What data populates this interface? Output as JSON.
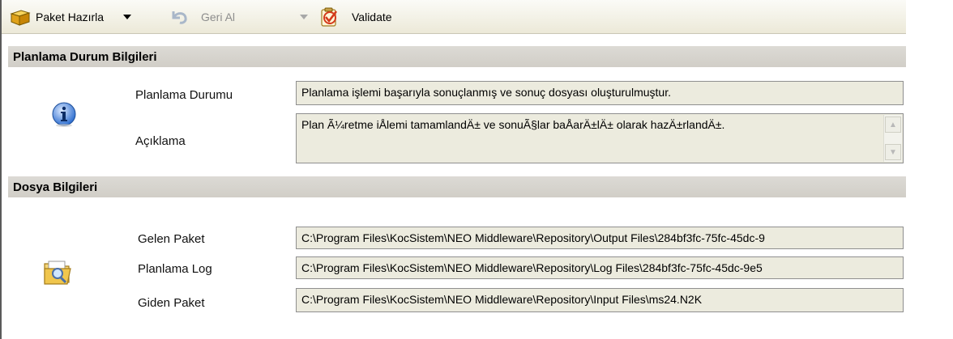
{
  "toolbar": {
    "package_label": "Paket Hazırla",
    "undo_label": "Geri Al",
    "validate_label": "Validate"
  },
  "planning_section": {
    "title": "Planlama Durum Bilgileri",
    "status_label": "Planlama Durumu",
    "status_value": "Planlama işlemi başarıyla sonuçlanmış ve sonuç dosyası oluşturulmuştur.",
    "description_label": "Açıklama",
    "description_value": "Plan Ã¼retme iÅlemi tamamlandÄ± ve sonuÃ§lar baÅarÄ±lÄ± olarak hazÄ±rlandÄ±."
  },
  "file_section": {
    "title": "Dosya Bilgileri",
    "incoming_label": "Gelen Paket",
    "incoming_value": "C:\\Program Files\\KocSistem\\NEO Middleware\\Repository\\Output Files\\284bf3fc-75fc-45dc-9",
    "log_label": "Planlama Log",
    "log_value": "C:\\Program Files\\KocSistem\\NEO Middleware\\Repository\\Log Files\\284bf3fc-75fc-45dc-9e5",
    "outgoing_label": "Giden Paket",
    "outgoing_value": "C:\\Program Files\\KocSistem\\NEO Middleware\\Repository\\Input Files\\ms24.N2K"
  },
  "colors": {
    "section_header": "#d4d0c8",
    "readonly_field": "#ecebde",
    "info_icon": "#2f6fd0"
  }
}
